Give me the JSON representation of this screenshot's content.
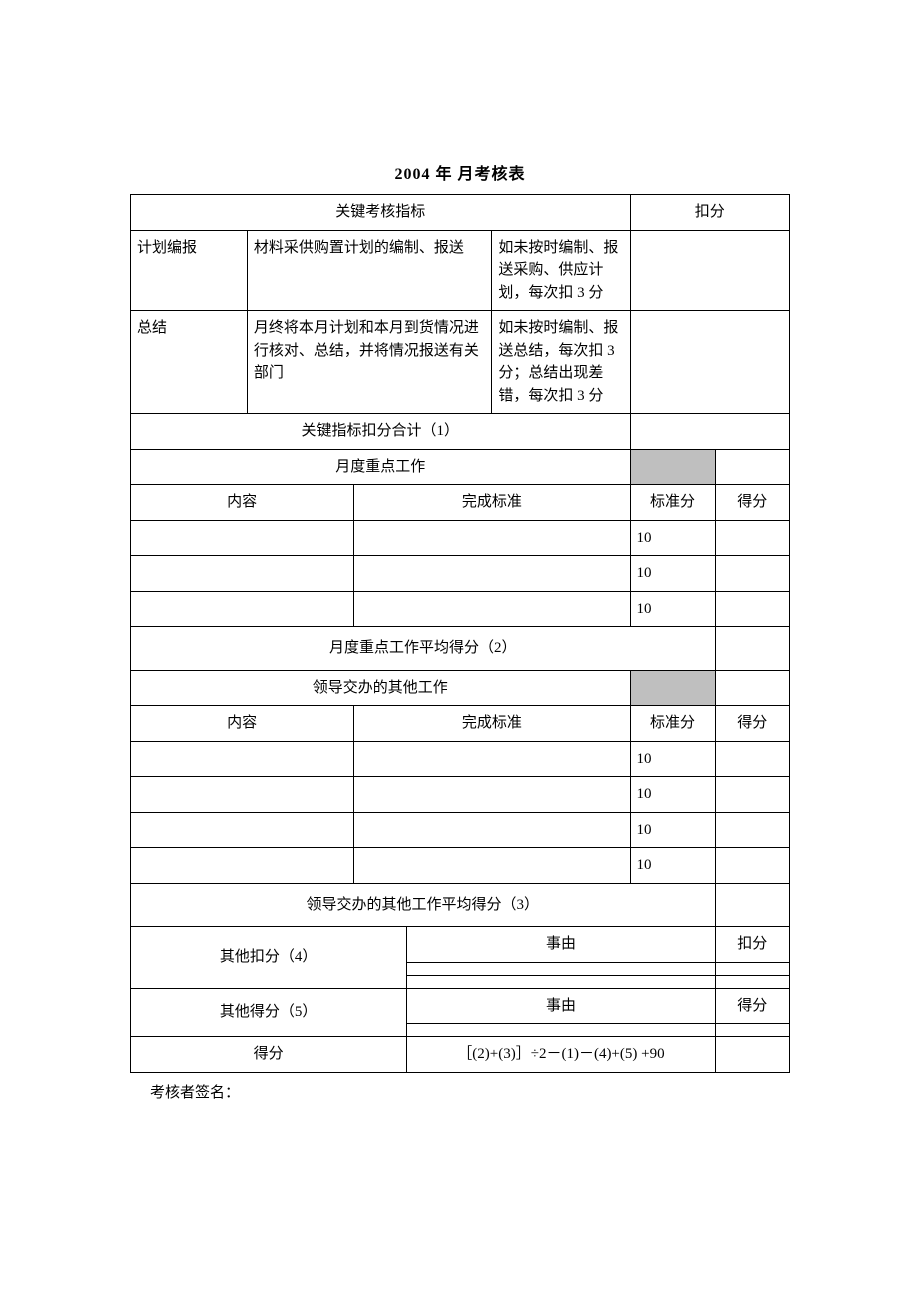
{
  "title": "2004 年   月考核表",
  "header": {
    "key_indicator": "关键考核指标",
    "deduct": "扣分"
  },
  "kpi_rows": [
    {
      "name": "计划编报",
      "desc": "材料采供购置计划的编制、报送",
      "rule": "如未按时编制、报送采购、供应计划，每次扣 3 分"
    },
    {
      "name": "总结",
      "desc": "月终将本月计划和本月到货情况进行核对、总结，并将情况报送有关部门",
      "rule": "如未按时编制、报送总结，每次扣 3 分；总结出现差错，每次扣 3 分"
    }
  ],
  "kpi_total_label": "关键指标扣分合计（1）",
  "monthly_section": "月度重点工作",
  "col": {
    "content": "内容",
    "standard": "完成标准",
    "std_score": "标准分",
    "score": "得分"
  },
  "monthly_rows": [
    {
      "std": "10"
    },
    {
      "std": "10"
    },
    {
      "std": "10"
    }
  ],
  "monthly_avg_label": "月度重点工作平均得分（2）",
  "other_section": "领导交办的其他工作",
  "other_rows": [
    {
      "std": "10"
    },
    {
      "std": "10"
    },
    {
      "std": "10"
    },
    {
      "std": "10"
    }
  ],
  "other_avg_label": "领导交办的其他工作平均得分（3）",
  "extra_deduct": {
    "label": "其他扣分（4）",
    "reason_label": "事由",
    "score_label": "扣分"
  },
  "extra_add": {
    "label": "其他得分（5）",
    "reason_label": "事由",
    "score_label": "得分"
  },
  "final": {
    "label": "得分",
    "formula": "［(2)+(3)］÷2－(1)－(4)+(5)  +90"
  },
  "signature_label": "考核者签名："
}
